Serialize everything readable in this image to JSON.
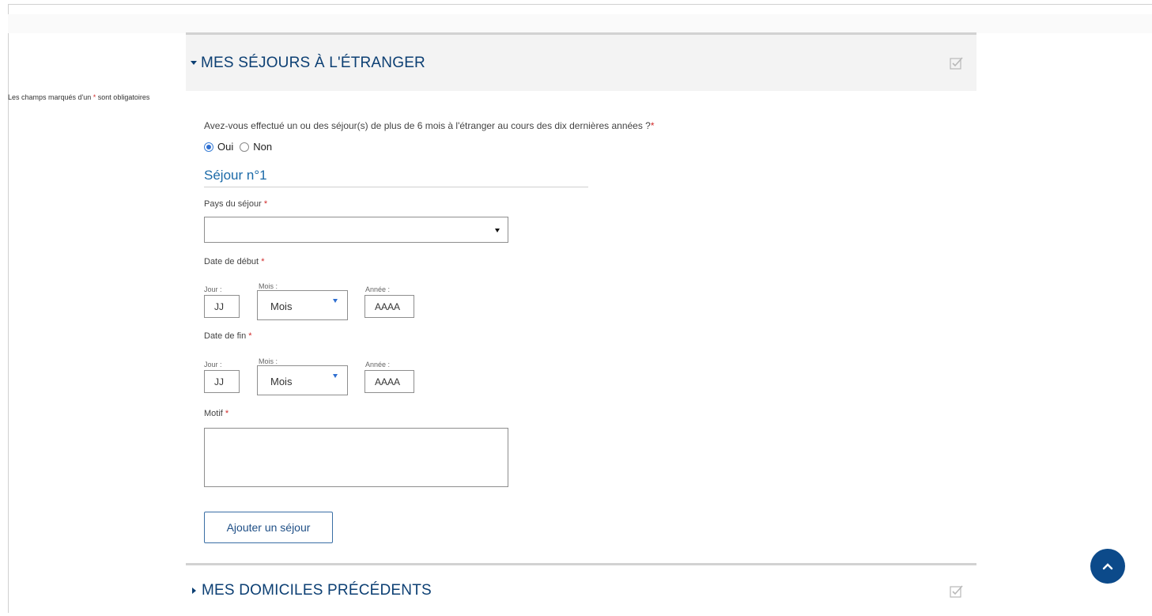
{
  "section_open": {
    "title": "MES SÉJOURS À L'ÉTRANGER",
    "check_icon": "checkbox-checked-icon"
  },
  "required_note": {
    "before": "Les champs marqués d'un ",
    "star": "*",
    "after": " sont obligatoires"
  },
  "question": {
    "text": "Avez-vous effectué un ou des séjour(s) de plus de 6 mois à l'étranger au cours des dix dernières années ?",
    "star": "*"
  },
  "radios": {
    "yes_label": "Oui",
    "no_label": "Non",
    "selected": "Oui"
  },
  "stay": {
    "title": "Séjour n°1",
    "country_label": "Pays du séjour",
    "country_value": "",
    "start_label": "Date de début",
    "end_label": "Date de fin",
    "day_label": "Jour :",
    "month_label": "Mois :",
    "year_label": "Année :",
    "day_placeholder": "JJ",
    "month_value": "Mois",
    "year_placeholder": "AAAA",
    "reason_label": "Motif",
    "star": "*"
  },
  "add_button_label": "Ajouter un séjour",
  "section_closed": {
    "title": "MES DOMICILES PRÉCÉDENTS",
    "check_icon": "checkbox-checked-icon"
  },
  "colors": {
    "heading_blue": "#0c3f73",
    "subtitle_blue": "#1b6aa8",
    "required_red": "#d12b2b",
    "scroll_button": "#0c4a8a"
  }
}
